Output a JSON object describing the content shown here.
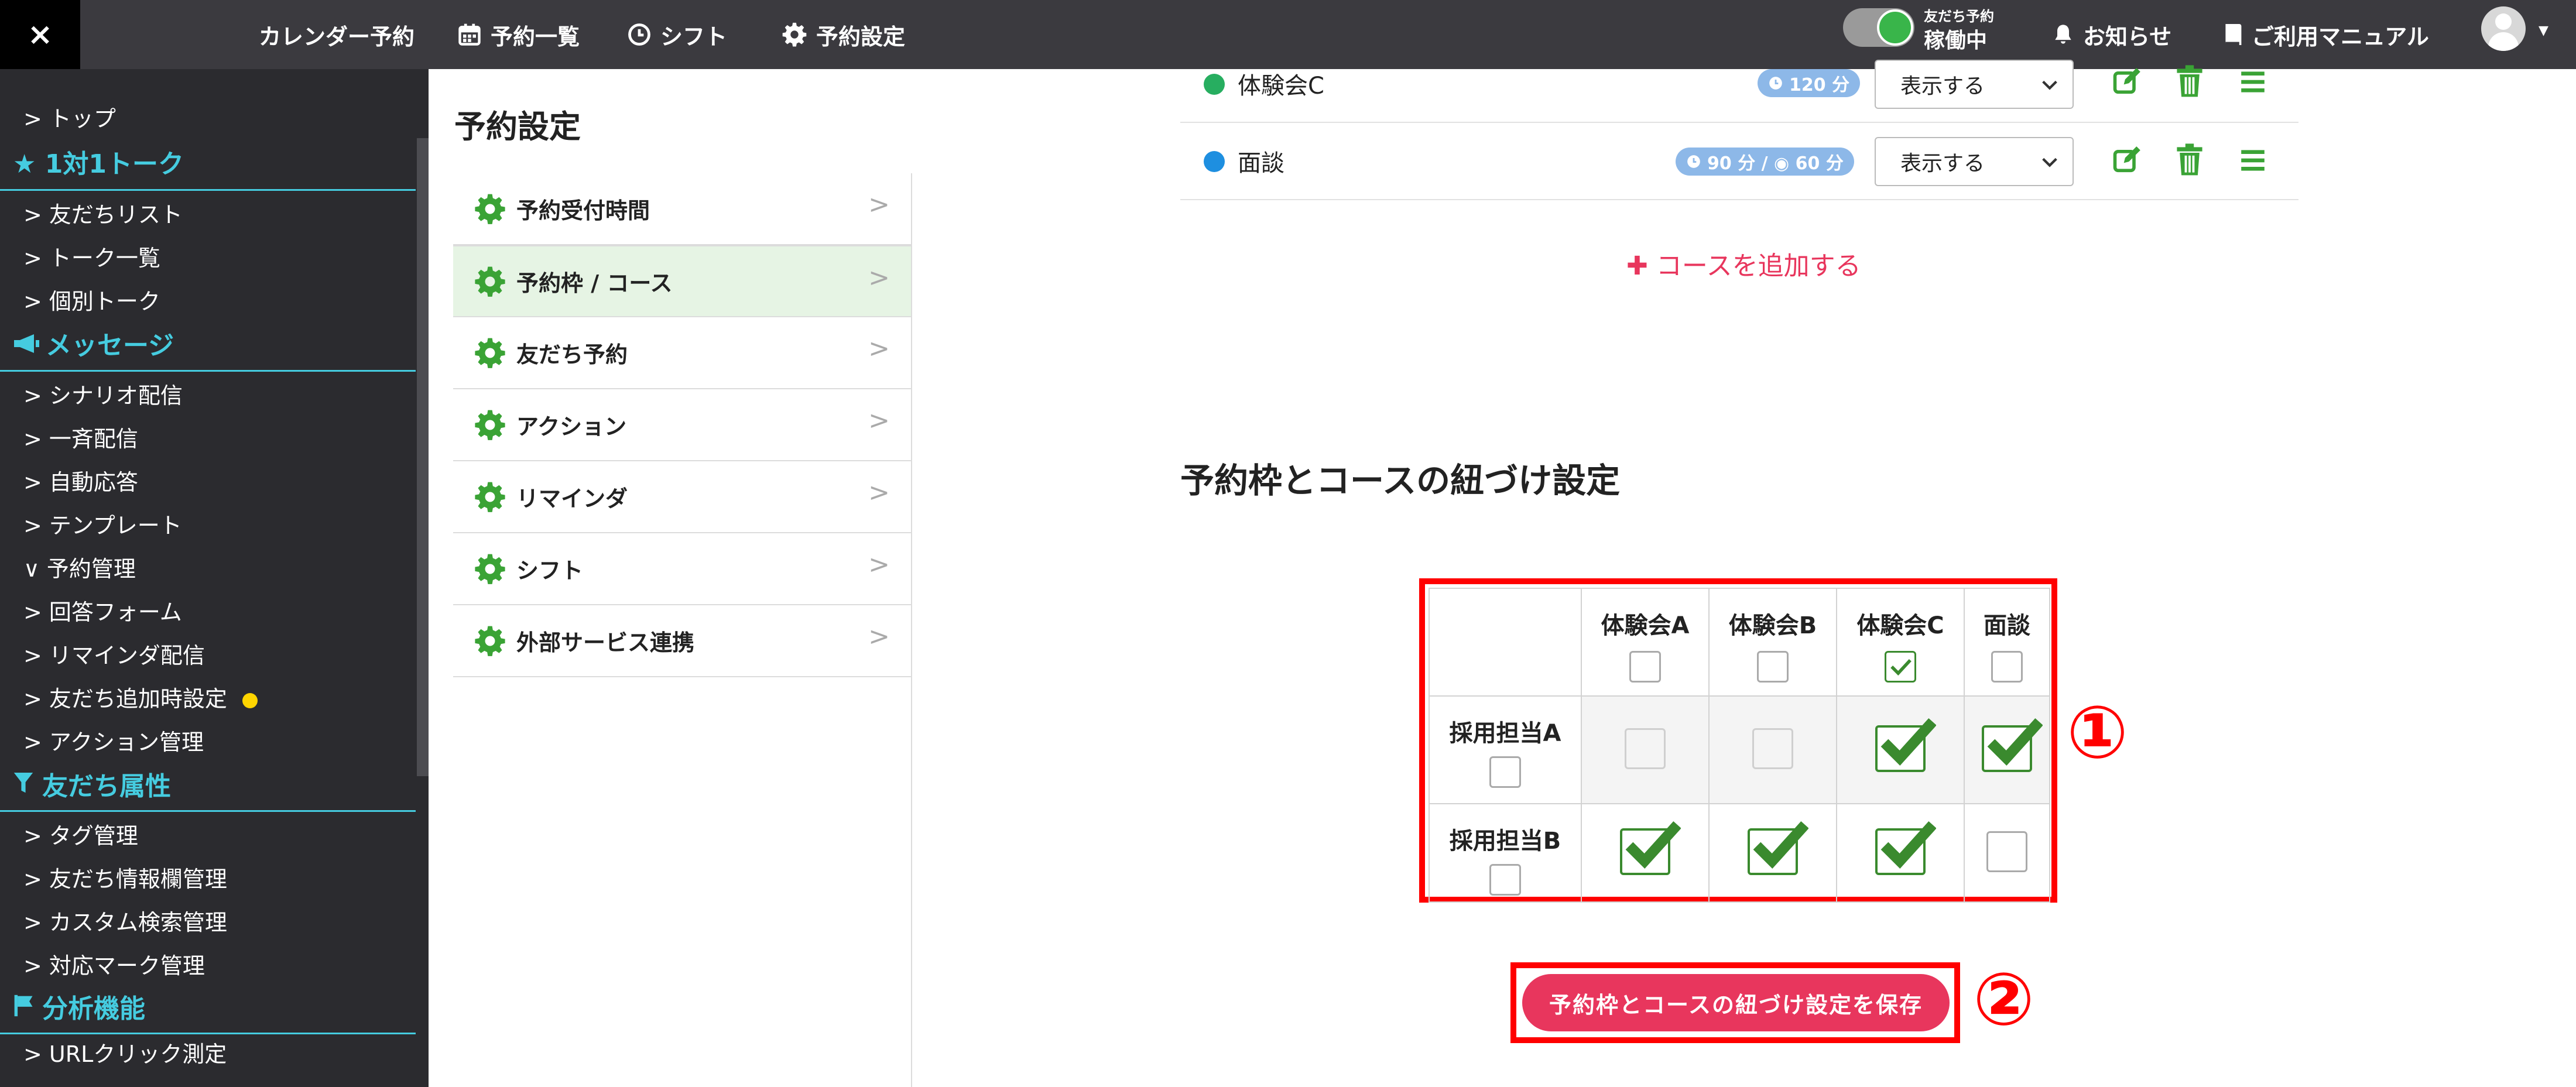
{
  "topbar": {
    "close_label": "×",
    "nav": [
      "カレンダー予約",
      "予約一覧",
      "シフト",
      "予約設定"
    ],
    "toggle_small": "友だち予約",
    "toggle_status": "稼働中",
    "notice": "お知らせ",
    "manual": "ご利用マニュアル"
  },
  "sidebar": {
    "items": [
      {
        "type": "item",
        "label": "> トップ"
      },
      {
        "type": "category",
        "icon": "star-icon",
        "label": "★ 1対1トーク"
      },
      {
        "type": "item",
        "label": "> 友だちリスト"
      },
      {
        "type": "item",
        "label": "> トーク一覧"
      },
      {
        "type": "item",
        "label": "> 個別トーク"
      },
      {
        "type": "category",
        "icon": "megaphone-icon",
        "label": "メッセージ"
      },
      {
        "type": "item",
        "label": "> シナリオ配信"
      },
      {
        "type": "item",
        "label": "> 一斉配信"
      },
      {
        "type": "item",
        "label": "> 自動応答"
      },
      {
        "type": "item",
        "label": "> テンプレート"
      },
      {
        "type": "item",
        "label": "∨ 予約管理"
      },
      {
        "type": "item",
        "label": "> 回答フォーム"
      },
      {
        "type": "item",
        "label": "> リマインダ配信"
      },
      {
        "type": "item",
        "label": "> 友だち追加時設定"
      },
      {
        "type": "item",
        "label": "> アクション管理"
      },
      {
        "type": "category",
        "icon": "filter-icon",
        "label": "友だち属性"
      },
      {
        "type": "item",
        "label": "> タグ管理"
      },
      {
        "type": "item",
        "label": "> 友だち情報欄管理"
      },
      {
        "type": "item",
        "label": "> カスタム検索管理"
      },
      {
        "type": "item",
        "label": "> 対応マーク管理"
      },
      {
        "type": "category",
        "icon": "flag-icon",
        "label": "分析機能"
      },
      {
        "type": "item",
        "label": "> URLクリック測定"
      }
    ]
  },
  "settings": {
    "title": "予約設定",
    "menu": [
      "予約受付時間",
      "予約枠 / コース",
      "友だち予約",
      "アクション",
      "リマインダ",
      "シフト",
      "外部サービス連携"
    ],
    "active_index": 1
  },
  "courses": [
    {
      "name": "体験会C",
      "dot_color": "#27ae60",
      "badge": "120 分",
      "select": "表示する"
    },
    {
      "name": "面談",
      "dot_color": "#1e8fe0",
      "badge": "90 分 / ◉ 60 分",
      "select": "表示する"
    }
  ],
  "add_course_label": "✚ コースを追加する",
  "link_section": {
    "title": "予約枠とコースの紐づけ設定",
    "columns": [
      "体験会A",
      "体験会B",
      "体験会C",
      "面談"
    ],
    "header_checked": [
      false,
      false,
      true,
      false
    ],
    "rows": [
      {
        "label": "採用担当A",
        "cells": [
          "disabled",
          "disabled",
          "checked",
          "checked"
        ]
      },
      {
        "label": "採用担当B",
        "cells": [
          "checked",
          "checked",
          "checked",
          "empty"
        ]
      }
    ],
    "save_label": "予約枠とコースの紐づけ設定を保存"
  },
  "annotations": {
    "marker1": "①",
    "marker2": "②"
  },
  "colors": {
    "accent_red": "#e8365d",
    "sidebar_accent": "#45cce0",
    "check_green": "#3a8a2e",
    "gear_green": "#3aa335"
  }
}
